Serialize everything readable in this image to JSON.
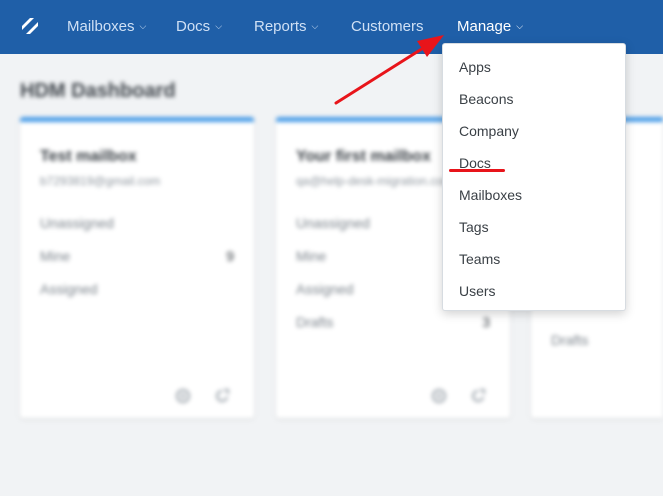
{
  "nav": {
    "items": [
      {
        "label": "Mailboxes",
        "has_caret": true
      },
      {
        "label": "Docs",
        "has_caret": true
      },
      {
        "label": "Reports",
        "has_caret": true
      },
      {
        "label": "Customers",
        "has_caret": false
      },
      {
        "label": "Manage",
        "has_caret": true,
        "active": true
      }
    ]
  },
  "page": {
    "title": "HDM Dashboard"
  },
  "cards": [
    {
      "title": "Test mailbox",
      "email": "b7293819@gmail.com",
      "stats": [
        {
          "label": "Unassigned",
          "count": ""
        },
        {
          "label": "Mine",
          "count": "9"
        },
        {
          "label": "Assigned",
          "count": ""
        }
      ]
    },
    {
      "title": "Your first mailbox",
      "email": "qa@help-desk-migration.com",
      "stats": [
        {
          "label": "Unassigned",
          "count": ""
        },
        {
          "label": "Mine",
          "count": ""
        },
        {
          "label": "Assigned",
          "count": ""
        },
        {
          "label": "Drafts",
          "count": "3"
        }
      ]
    },
    {
      "title": "",
      "email": "",
      "stats": [
        {
          "label": "Drafts",
          "count": ""
        }
      ]
    }
  ],
  "manage_menu": {
    "items": [
      "Apps",
      "Beacons",
      "Company",
      "Docs",
      "Mailboxes",
      "Tags",
      "Teams",
      "Users"
    ],
    "highlighted": "Docs"
  },
  "colors": {
    "topbar": "#1f5fa8",
    "card_accent": "#4a9de8",
    "annotation": "#e8141a"
  }
}
